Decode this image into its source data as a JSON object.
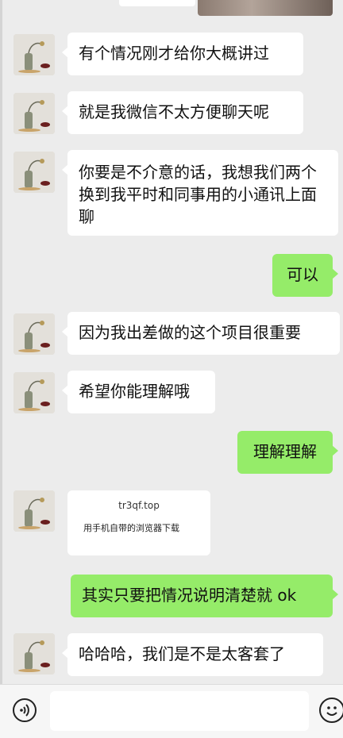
{
  "messages": [
    {
      "side": "left",
      "text": "有个情况刚才给你大概讲过"
    },
    {
      "side": "left",
      "text": "就是我微信不太方便聊天呢"
    },
    {
      "side": "left",
      "text": "你要是不介意的话，我想我们两个换到我平时和同事用的小通讯上面聊"
    },
    {
      "side": "right",
      "text": "可以"
    },
    {
      "side": "left",
      "text": "因为我出差做的这个项目很重要"
    },
    {
      "side": "left",
      "text": "希望你能理解哦"
    },
    {
      "side": "right",
      "text": "理解理解"
    },
    {
      "side": "left",
      "type": "card",
      "line1": "tr3qf.top",
      "line2": "用手机自带的浏览器下载"
    },
    {
      "side": "right",
      "text": "其实只要把情况说明清楚就 ok"
    },
    {
      "side": "left",
      "text": "哈哈哈，我们是不是太客套了"
    }
  ],
  "input_bar": {
    "voice_icon": "voice-icon",
    "emoji_icon": "emoji-icon",
    "input_value": ""
  },
  "colors": {
    "background": "#ececec",
    "right_bubble": "#95ec69",
    "left_bubble": "#ffffff"
  }
}
